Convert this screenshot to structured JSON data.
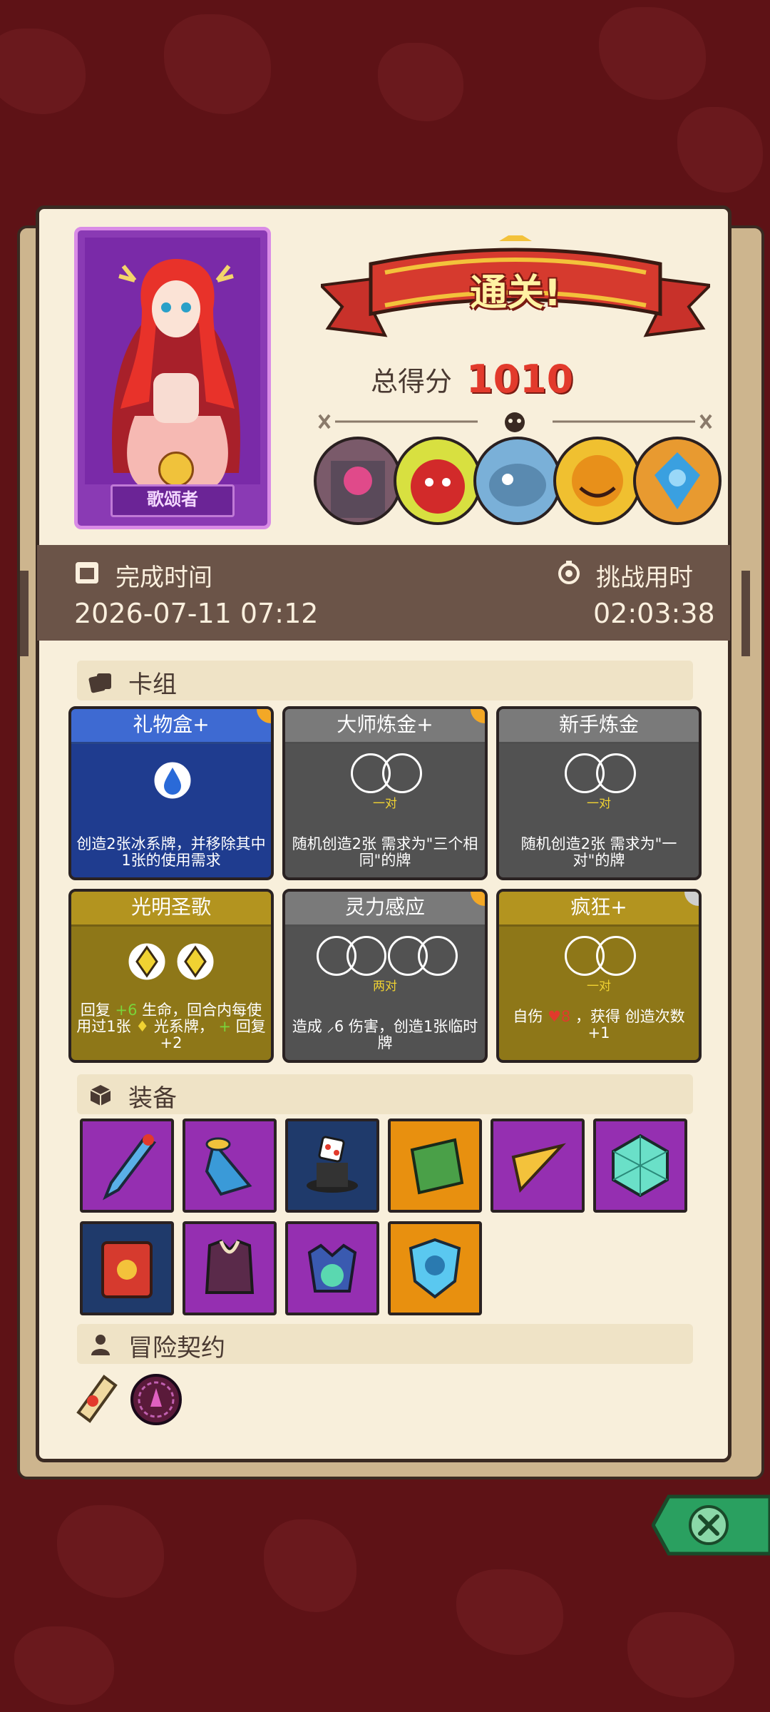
{
  "hero": {
    "name": "歌颂者"
  },
  "result": {
    "banner": "通关!",
    "score_label": "总得分",
    "score_value": "1010"
  },
  "time": {
    "finish_label": "完成时间",
    "finish_value": "2026-07-11 07:12",
    "duration_label": "挑战用时",
    "duration_value": "02:03:38"
  },
  "deck": {
    "header": "卡组",
    "cards": [
      {
        "title": "礼物盒+",
        "desc": "创造2张冰系牌，并移除其中1张的使用需求",
        "sub": "",
        "color": "blue"
      },
      {
        "title": "大师炼金+",
        "desc": "随机创造2张 需求为\"三个相同\"的牌",
        "sub": "一对",
        "color": "gray"
      },
      {
        "title": "新手炼金",
        "desc": "随机创造2张 需求为\"一对\"的牌",
        "sub": "一对",
        "color": "gray"
      },
      {
        "title": "光明圣歌",
        "desc_a": "回复",
        "desc_b": "+6",
        "desc_c": "生命，回合内每使用过1张",
        "desc_d": "光系牌，",
        "desc_e": "+",
        "desc_f": "回复+2",
        "color": "gold"
      },
      {
        "title": "灵力感应",
        "desc": "造成 ⸝6 伤害，创造1张临时牌",
        "sub": "两对",
        "color": "gray"
      },
      {
        "title": "疯狂+",
        "desc_a": "自伤",
        "desc_b": "♥8",
        "desc_c": "，获得 创造次数+1",
        "sub": "一对",
        "color": "gold"
      }
    ]
  },
  "equipment": {
    "header": "装备"
  },
  "contract": {
    "header": "冒险契约"
  },
  "colors": {
    "accent": "#e23a2c",
    "panel": "#f8efdb",
    "strip": "#6b5448"
  }
}
